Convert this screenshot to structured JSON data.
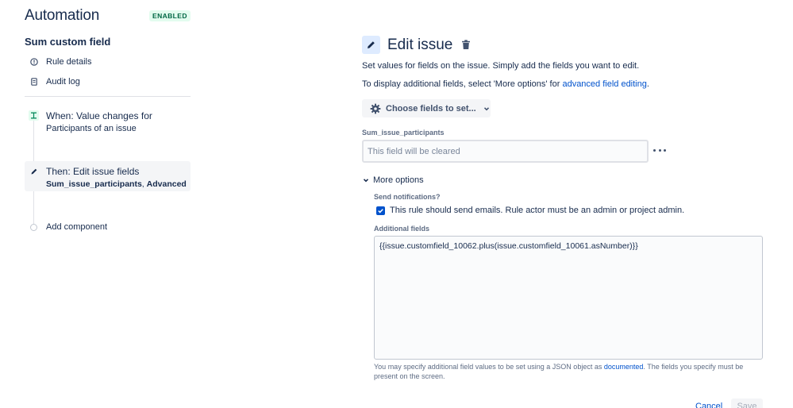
{
  "app": {
    "title": "Automation",
    "status": "ENABLED"
  },
  "sidebar": {
    "rule_name": "Sum custom field",
    "nav": [
      {
        "label": "Rule details",
        "icon": "info-icon"
      },
      {
        "label": "Audit log",
        "icon": "clipboard-icon"
      }
    ],
    "components": {
      "trigger": {
        "title": "When: Value changes for",
        "subtitle": "Participants of an issue",
        "icon": "trigger-icon"
      },
      "action": {
        "title": "Then: Edit issue fields",
        "subtitle_bold": "Sum_issue_participants",
        "subtitle_sep": ", ",
        "subtitle_bold2": "Advanced",
        "icon": "pencil-icon"
      },
      "add_label": "Add component"
    }
  },
  "editor": {
    "title": "Edit issue",
    "description1": "Set values for fields on the issue. Simply add the fields you want to edit.",
    "description2_prefix": "To display additional fields, select 'More options' for ",
    "description2_link": "advanced field editing",
    "description2_suffix": ".",
    "choose_fields_label": "Choose fields to set...",
    "field": {
      "label": "Sum_issue_participants",
      "placeholder": "This field will be cleared",
      "value": ""
    },
    "more_options_label": "More options",
    "notifications": {
      "label": "Send notifications?",
      "checkbox_label": "This rule should send emails. Rule actor must be an admin or project admin.",
      "checked": true
    },
    "additional_fields": {
      "label": "Additional fields",
      "value": "{{issue.customfield_10062.plus(issue.customfield_10061.asNumber)}}",
      "help_prefix": "You may specify additional field values to be set using a JSON object as ",
      "help_link": "documented",
      "help_suffix": ". The fields you specify must be present on the screen."
    },
    "cancel_label": "Cancel",
    "save_label": "Save"
  },
  "colors": {
    "primary": "#0052cc",
    "text": "#172b4d",
    "subtle": "#5e6c84",
    "enabled_bg": "#e3fcef",
    "enabled_text": "#006644"
  }
}
